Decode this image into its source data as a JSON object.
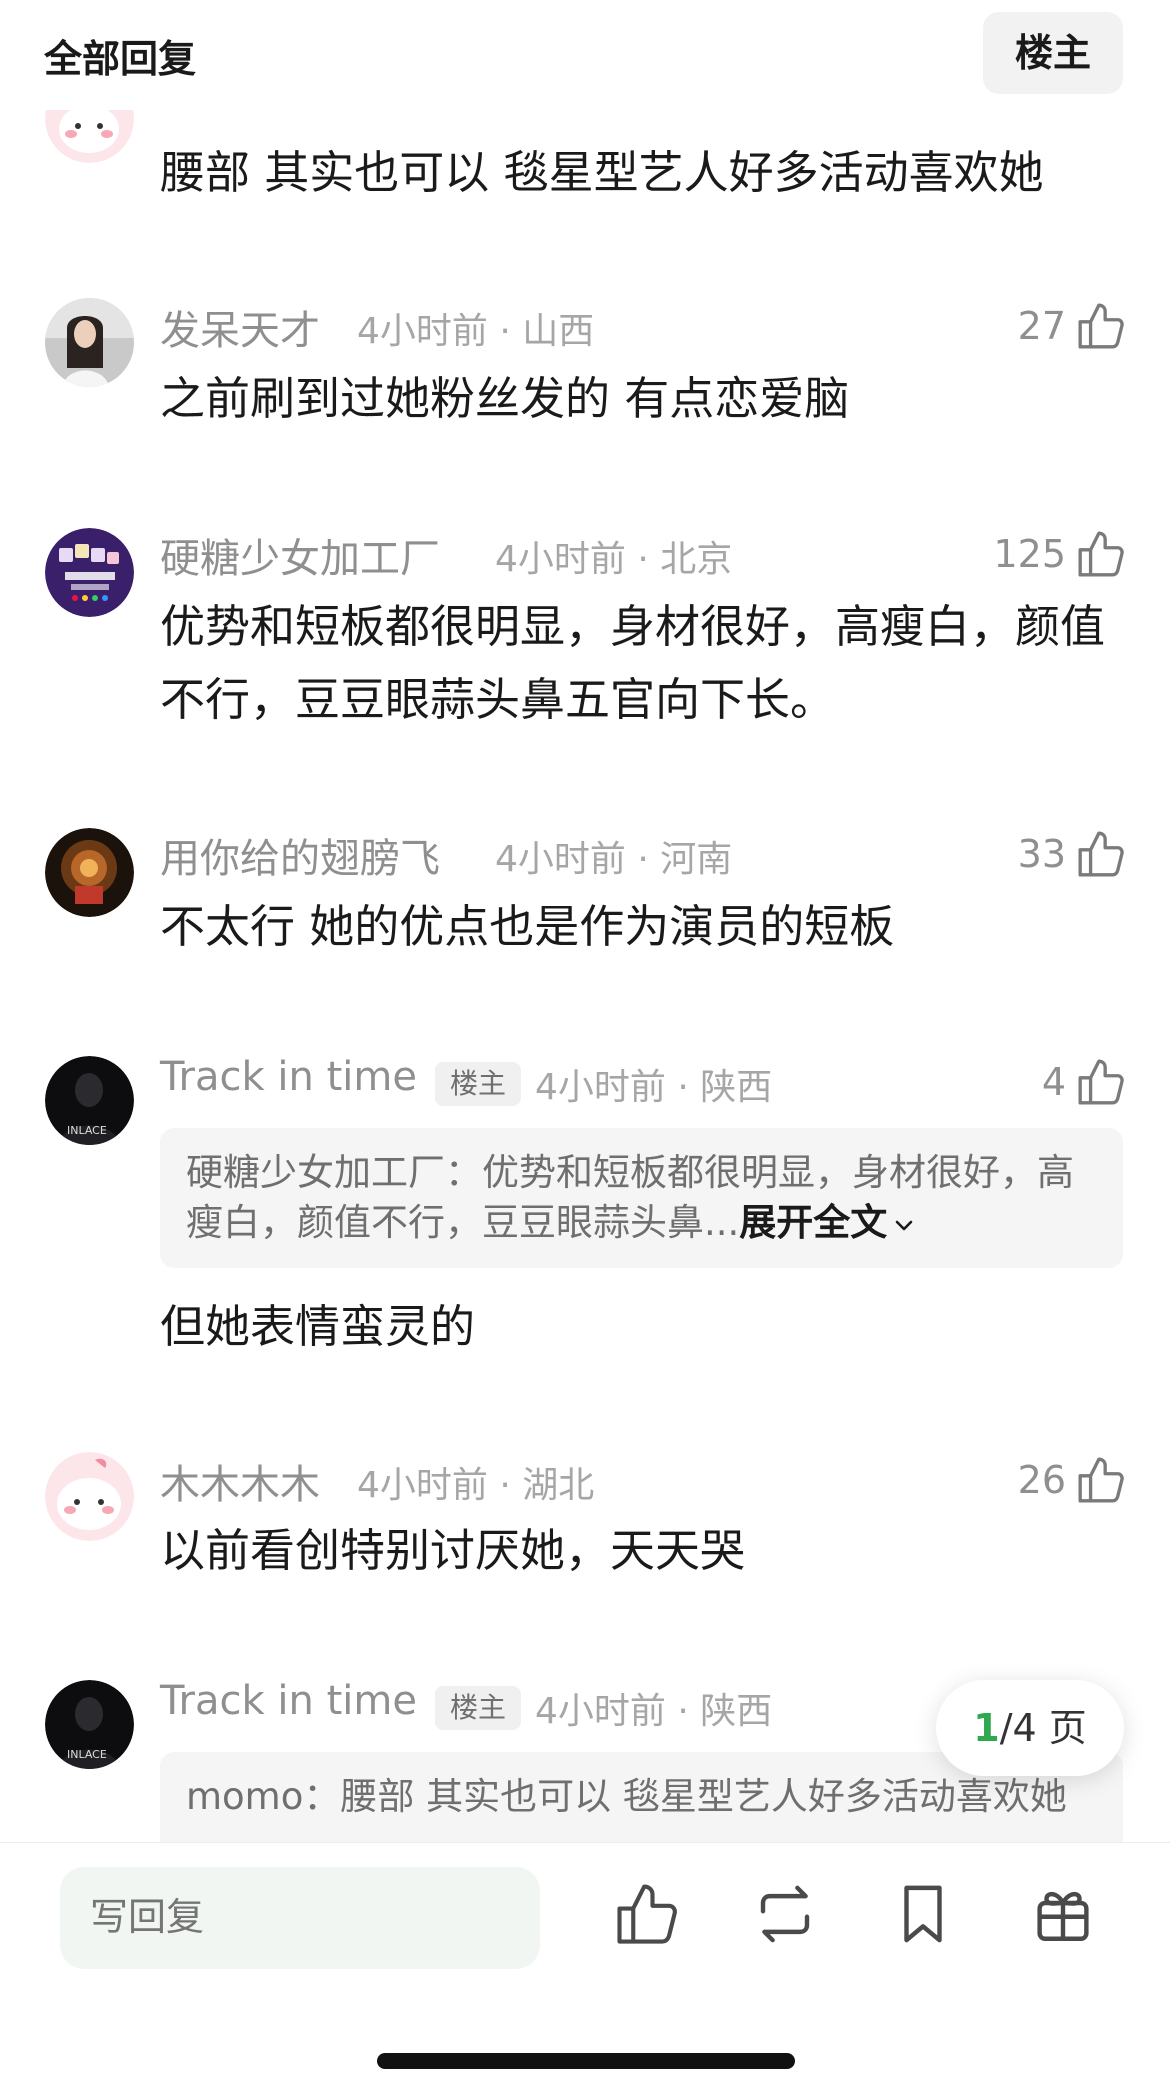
{
  "header": {
    "title": "全部回复",
    "op_filter_label": "楼主"
  },
  "comments": [
    {
      "username": "",
      "meta": "",
      "likes": "",
      "body": "腰部 其实也可以 毯星型艺人好多活动喜欢她",
      "avatar_icon": "pink-cartoon-avatar"
    },
    {
      "username": "发呆天才",
      "meta": "4小时前 · 山西",
      "likes": "27",
      "body": "之前刷到过她粉丝发的 有点恋爱脑",
      "avatar_icon": "photo-avatar"
    },
    {
      "username": "硬糖少女加工厂",
      "meta": "4小时前 · 北京",
      "likes": "125",
      "body": "优势和短板都很明显，身材很好，高瘦白，颜值不行，豆豆眼蒜头鼻五官向下长。",
      "avatar_icon": "group-logo-avatar"
    },
    {
      "username": "用你给的翅膀飞",
      "meta": "4小时前 · 河南",
      "likes": "33",
      "body": "不太行 她的优点也是作为演员的短板",
      "avatar_icon": "dark-photo-avatar"
    },
    {
      "username": "Track in time",
      "op_tag": "楼主",
      "meta": "4小时前 · 陕西",
      "likes": "4",
      "quote_user": "硬糖少女加工厂：",
      "quote_text": "优势和短板都很明显，身材很好，高瘦白，颜值不行，豆豆眼蒜头鼻...",
      "expand_label": "展开全文",
      "body": "但她表情蛮灵的",
      "avatar_icon": "dark-portrait-avatar"
    },
    {
      "username": "木木木木",
      "meta": "4小时前 · 湖北",
      "likes": "26",
      "body": "以前看创特别讨厌她，天天哭",
      "avatar_icon": "pink-cartoon-avatar"
    },
    {
      "username": "Track in time",
      "op_tag": "楼主",
      "meta": "4小时前 · 陕西",
      "likes": "",
      "quote_user": "momo：",
      "quote_text": "腰部 其实也可以 毯星型艺人好多活动喜欢她",
      "avatar_icon": "dark-portrait-avatar"
    }
  ],
  "pager": {
    "current": "1",
    "total": "/4 页"
  },
  "bottom_bar": {
    "reply_placeholder": "写回复",
    "icons": [
      "like-icon",
      "repost-icon",
      "bookmark-icon",
      "gift-icon"
    ]
  },
  "colors": {
    "accent": "#2fa84f",
    "meta_gray": "#a6a6a6",
    "text": "#1a1a1a"
  }
}
